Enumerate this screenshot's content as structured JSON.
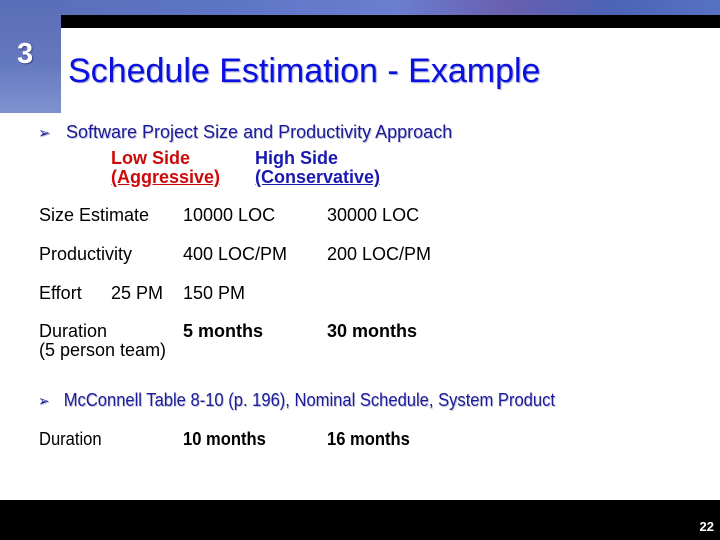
{
  "slide": {
    "section_number": "3",
    "title": "Schedule Estimation - Example",
    "page_number": "22"
  },
  "bullets": [
    {
      "icon": "arrow-bullet-icon",
      "text": "Software Project Size and Productivity Approach"
    },
    {
      "icon": "arrow-bullet-icon",
      "text": "McConnell Table 8-10 (p. 196), Nominal Schedule, System Product"
    }
  ],
  "columns": {
    "low": {
      "line1": "Low Side",
      "line2": "(Aggressive)",
      "color": "#cc0a0a"
    },
    "high": {
      "line1": "High Side",
      "line2": "(Conservative)",
      "color": "#1a1ab0"
    }
  },
  "rows": {
    "size": {
      "label": "Size Estimate",
      "low": "10000 LOC",
      "high": "30000 LOC"
    },
    "productivity": {
      "label": "Productivity",
      "low": "400 LOC/PM",
      "high": "200 LOC/PM"
    },
    "effort": {
      "label": "Effort",
      "low": "25 PM",
      "high": "150 PM"
    },
    "duration": {
      "label": "Duration",
      "sublabel": "(5 person team)",
      "low": "5 months",
      "high": "30 months"
    },
    "mcconnell_duration": {
      "label": "Duration",
      "low": "10 months",
      "high": "16 months"
    }
  },
  "colors": {
    "title": "#0a10e0",
    "bullet_text": "#1a1a9a",
    "accent_strip": "#5a6db8"
  }
}
